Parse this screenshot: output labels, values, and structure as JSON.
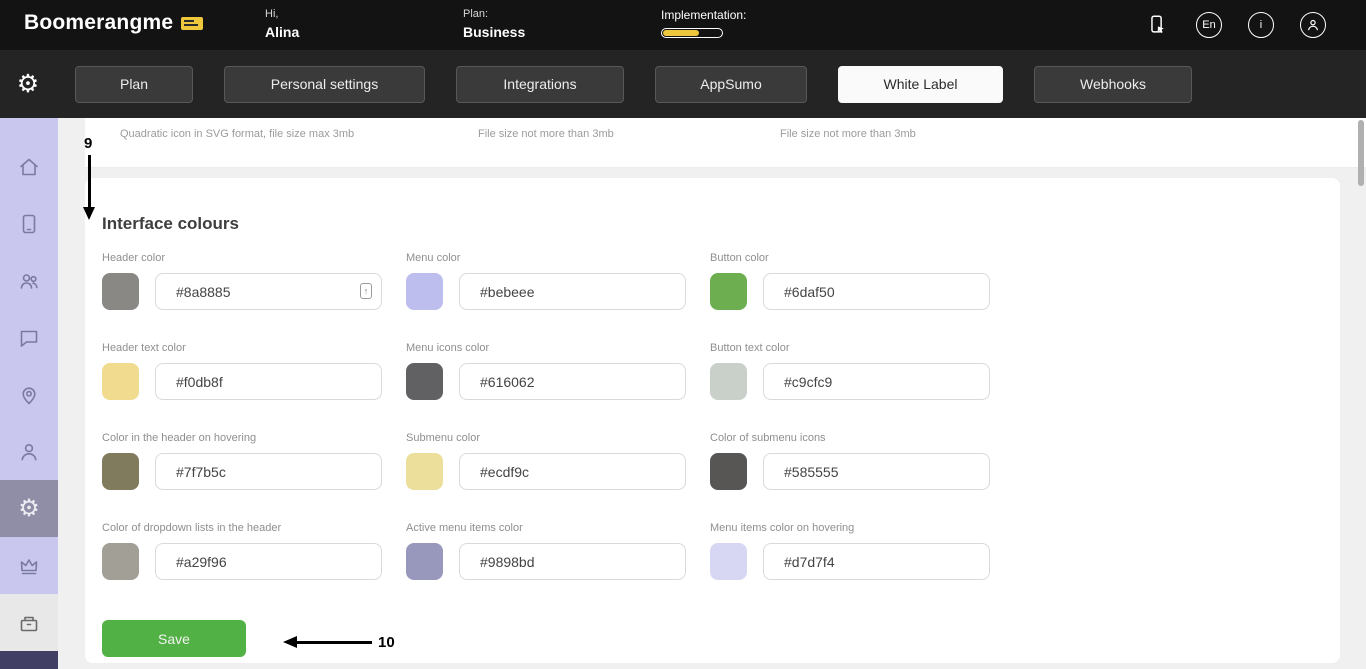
{
  "header": {
    "logo_text": "Boomerangme",
    "greeting_label": "Hi,",
    "user_name": "Alina",
    "plan_label": "Plan:",
    "plan_value": "Business",
    "implementation_label": "Implementation:",
    "implementation_progress": "62%",
    "language_label": "En",
    "info_label": "i"
  },
  "nav": {
    "tabs": [
      {
        "label": "Plan",
        "active": false
      },
      {
        "label": "Personal settings",
        "active": false
      },
      {
        "label": "Integrations",
        "active": false
      },
      {
        "label": "AppSumo",
        "active": false
      },
      {
        "label": "White Label",
        "active": true
      },
      {
        "label": "Webhooks",
        "active": false
      }
    ]
  },
  "sidebar": {
    "items": [
      "home",
      "cards",
      "contacts",
      "chat",
      "locations",
      "clients",
      "settings",
      "subscription",
      "billing"
    ],
    "active_item": "settings"
  },
  "upload_hints": {
    "hint_1": "Quadratic icon in SVG format, file size max 3mb",
    "hint_2": "File size not more than 3mb",
    "hint_3": "File size not more than 3mb"
  },
  "interface_colours": {
    "title": "Interface colours",
    "fields": [
      {
        "label": "Header color",
        "value": "#8a8885"
      },
      {
        "label": "Menu color",
        "value": "#bebeee"
      },
      {
        "label": "Button color",
        "value": "#6daf50"
      },
      {
        "label": "Header text color",
        "value": "#f0db8f"
      },
      {
        "label": "Menu icons color",
        "value": "#616062"
      },
      {
        "label": "Button text color",
        "value": "#c9cfc9"
      },
      {
        "label": "Color in the header on hovering",
        "value": "#7f7b5c"
      },
      {
        "label": "Submenu color",
        "value": "#ecdf9c"
      },
      {
        "label": "Color of submenu icons",
        "value": "#585555"
      },
      {
        "label": "Color of dropdown lists in the header",
        "value": "#a29f96"
      },
      {
        "label": "Active menu items color",
        "value": "#9898bd"
      },
      {
        "label": "Menu items color on hovering",
        "value": "#d7d7f4"
      }
    ],
    "save_label": "Save"
  },
  "annotations": {
    "step_9": "9",
    "step_10": "10"
  }
}
